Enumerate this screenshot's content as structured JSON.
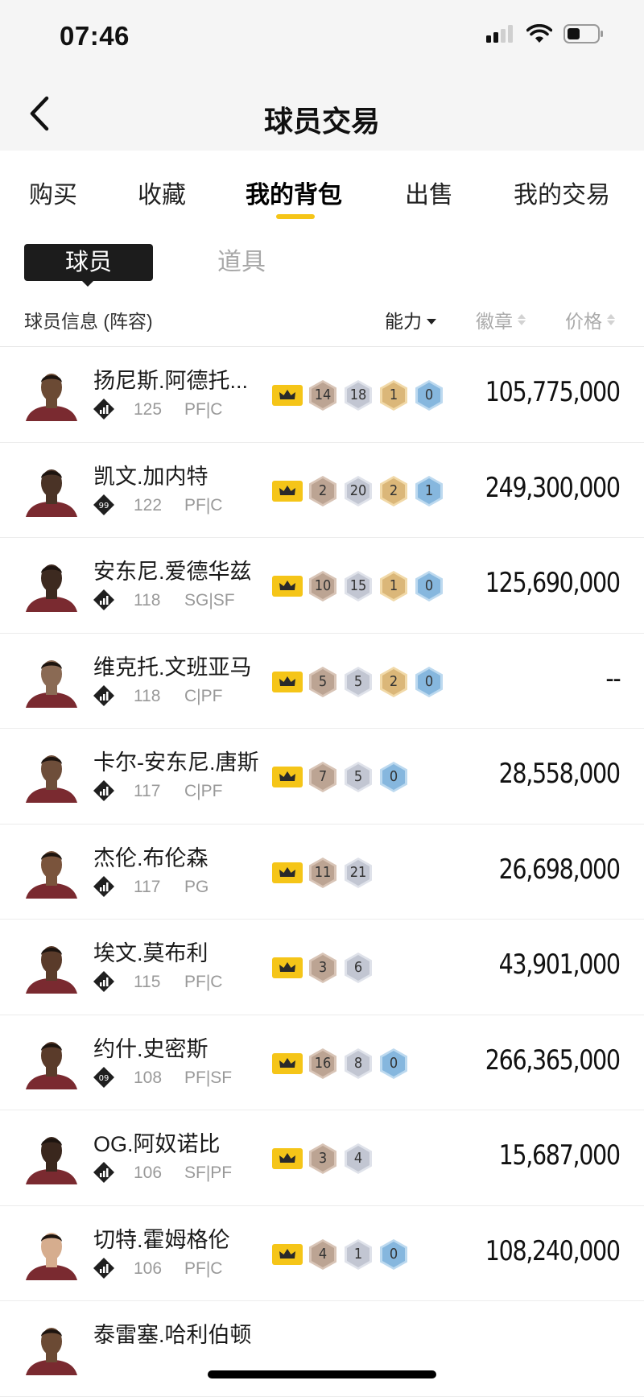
{
  "status_bar": {
    "time": "07:46"
  },
  "header": {
    "title": "球员交易"
  },
  "tabs": [
    "购买",
    "收藏",
    "我的背包",
    "出售",
    "我的交易"
  ],
  "segment": {
    "active": "球员",
    "inactive": "道具"
  },
  "columns": {
    "info": "球员信息 (阵容)",
    "ability": "能力",
    "badges": "徽章",
    "price": "价格"
  },
  "colors": {
    "accent": "#f5c518",
    "dark": "#1c1c1c",
    "muted": "#999999"
  },
  "players": [
    {
      "name": "扬尼斯.阿德托...",
      "tier": "",
      "ovr": "125",
      "pos": "PF|C",
      "badges": [
        "14",
        "18",
        "1",
        "0"
      ],
      "badge_types": [
        "bronze",
        "silver",
        "gold",
        "blue"
      ],
      "price": "105,775,000",
      "skin": "#6b4a34"
    },
    {
      "name": "凯文.加内特",
      "tier": "99",
      "ovr": "122",
      "pos": "PF|C",
      "badges": [
        "2",
        "20",
        "2",
        "1"
      ],
      "badge_types": [
        "bronze",
        "silver",
        "gold",
        "blue"
      ],
      "price": "249,300,000",
      "skin": "#4a3326"
    },
    {
      "name": "安东尼.爱德华兹",
      "tier": "",
      "ovr": "118",
      "pos": "SG|SF",
      "badges": [
        "10",
        "15",
        "1",
        "0"
      ],
      "badge_types": [
        "bronze",
        "silver",
        "gold",
        "blue"
      ],
      "price": "125,690,000",
      "skin": "#3d2a20"
    },
    {
      "name": "维克托.文班亚马",
      "tier": "",
      "ovr": "118",
      "pos": "C|PF",
      "badges": [
        "5",
        "5",
        "2",
        "0"
      ],
      "badge_types": [
        "bronze",
        "silver",
        "gold",
        "blue"
      ],
      "price": "--",
      "skin": "#8a6a54"
    },
    {
      "name": "卡尔-安东尼.唐斯",
      "tier": "",
      "ovr": "117",
      "pos": "C|PF",
      "badges": [
        "7",
        "5",
        "0"
      ],
      "badge_types": [
        "bronze",
        "silver",
        "blue"
      ],
      "price": "28,558,000",
      "skin": "#6e4e3a"
    },
    {
      "name": "杰伦.布伦森",
      "tier": "",
      "ovr": "117",
      "pos": "PG",
      "badges": [
        "11",
        "21"
      ],
      "badge_types": [
        "bronze",
        "silver"
      ],
      "price": "26,698,000",
      "skin": "#7a543c"
    },
    {
      "name": "埃文.莫布利",
      "tier": "",
      "ovr": "115",
      "pos": "PF|C",
      "badges": [
        "3",
        "6"
      ],
      "badge_types": [
        "bronze",
        "silver"
      ],
      "price": "43,901,000",
      "skin": "#5a3b2a"
    },
    {
      "name": "约什.史密斯",
      "tier": "09",
      "ovr": "108",
      "pos": "PF|SF",
      "badges": [
        "16",
        "8",
        "0"
      ],
      "badge_types": [
        "bronze",
        "silver",
        "blue"
      ],
      "price": "266,365,000",
      "skin": "#5a3b2a"
    },
    {
      "name": "OG.阿奴诺比",
      "tier": "",
      "ovr": "106",
      "pos": "SF|PF",
      "badges": [
        "3",
        "4"
      ],
      "badge_types": [
        "bronze",
        "silver"
      ],
      "price": "15,687,000",
      "skin": "#3a271d"
    },
    {
      "name": "切特.霍姆格伦",
      "tier": "",
      "ovr": "106",
      "pos": "PF|C",
      "badges": [
        "4",
        "1",
        "0"
      ],
      "badge_types": [
        "bronze",
        "silver",
        "blue"
      ],
      "price": "108,240,000",
      "skin": "#d6ad8e"
    },
    {
      "name": "泰雷塞.哈利伯顿",
      "tier": "",
      "ovr": "",
      "pos": "",
      "badges": [],
      "badge_types": [],
      "price": "",
      "skin": "#6b4a34"
    }
  ]
}
